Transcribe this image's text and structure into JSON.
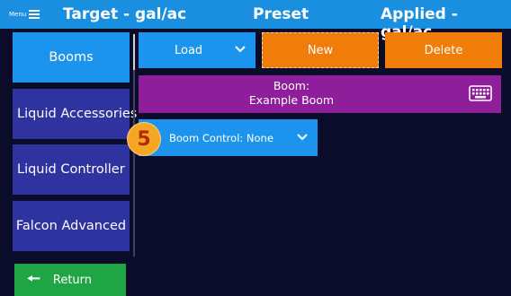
{
  "header": {
    "menu_label": "Menu",
    "target": "Target - gal/ac",
    "preset": "Preset",
    "applied": "Applied - gal/ac"
  },
  "sidebar": {
    "items": [
      {
        "label": "Booms"
      },
      {
        "label": "Liquid Accessories"
      },
      {
        "label": "Liquid Controller"
      },
      {
        "label": "Falcon Advanced"
      }
    ],
    "active_index": 0
  },
  "return_button": {
    "label": "Return"
  },
  "toolbar": {
    "load_label": "Load",
    "new_label": "New",
    "delete_label": "Delete"
  },
  "boom": {
    "line1": "Boom:",
    "line2": "Example Boom"
  },
  "boom_control": {
    "label": "Boom Control: None"
  },
  "step_badge": "5",
  "icons": [
    "menu-icon",
    "chevron-down-icon",
    "keyboard-icon",
    "arrow-left-icon"
  ],
  "colors": {
    "header_blue": "#1a8fe0",
    "sidebar_navy": "#2e33a0",
    "active_blue": "#1c94ee",
    "orange": "#f07d0a",
    "purple": "#8e1e9a",
    "green": "#1fa544",
    "background": "#0b0b2a"
  }
}
